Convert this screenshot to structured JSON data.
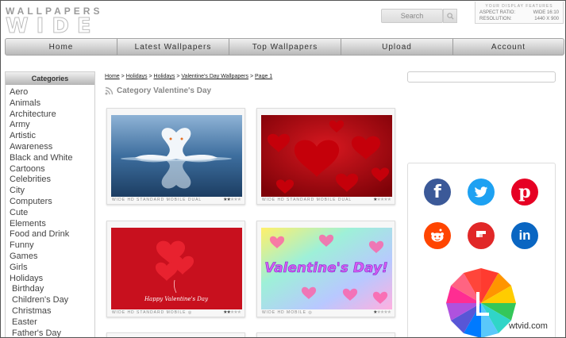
{
  "logo": {
    "line1": "WALLPAPERS",
    "line2": "WIDE"
  },
  "search": {
    "placeholder": "Search"
  },
  "display": {
    "heading": "YOUR DISPLAY FEATURES",
    "aspect_label": "ASPECT RATIO:",
    "aspect_value": "WIDE 16:10",
    "resolution_label": "RESOLUTION:",
    "resolution_value": "1440 X 900"
  },
  "nav": {
    "items": [
      "Home",
      "Latest Wallpapers",
      "Top Wallpapers",
      "Upload",
      "Account"
    ]
  },
  "sidebar": {
    "heading": "Categories",
    "items": [
      "Aero",
      "Animals",
      "Architecture",
      "Army",
      "Artistic",
      "Awareness",
      "Black and White",
      "Cartoons",
      "Celebrities",
      "City",
      "Computers",
      "Cute",
      "Elements",
      "Food and Drink",
      "Funny",
      "Games",
      "Girls",
      "Holidays"
    ],
    "sub_items": [
      "Birthday",
      "Children's Day",
      "Christmas",
      "Easter",
      "Father's Day"
    ]
  },
  "breadcrumb": {
    "home": "Home",
    "holidays1": "Holidays",
    "holidays2": "Holidays",
    "valentine": "Valentine's Day Wallpapers",
    "page": "Page 1",
    "sep": ">"
  },
  "category_title": "Category Valentine's Day",
  "cards": [
    {
      "tags": "WIDE HD STANDARD MOBILE DUAL",
      "rating": 2
    },
    {
      "tags": "WIDE HD STANDARD MOBILE DUAL",
      "rating": 1.5
    },
    {
      "tags": "WIDE HD STANDARD MOBILE ◎",
      "rating": 2,
      "caption": "Happy Valentine's Day"
    },
    {
      "tags": "WIDE HD MOBILE ◎",
      "rating": 1.5,
      "caption": "Valentine's Day!"
    }
  ],
  "social": {
    "icons": [
      "facebook-icon",
      "twitter-icon",
      "pinterest-icon",
      "reddit-icon",
      "flipboard-icon",
      "linkedin-icon"
    ],
    "colors": {
      "facebook": "#3b5998",
      "twitter": "#1da1f2",
      "pinterest": "#e60023",
      "reddit": "#ff4500",
      "flipboard": "#e12828",
      "linkedin": "#0a66c2"
    }
  },
  "watermark": "wtvid.com"
}
